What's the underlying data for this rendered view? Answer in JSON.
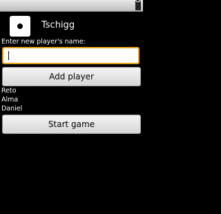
{
  "status_bar": {
    "time": "",
    "battery_level": 0.9
  },
  "app": {
    "title": "Tschigg",
    "icon": "dice-one-icon"
  },
  "form": {
    "name_label": "Enter new player's name:",
    "name_value": "",
    "name_placeholder": ""
  },
  "buttons": {
    "add_player": "Add player",
    "start_game": "Start game"
  },
  "players": [
    "Reto",
    "Alma",
    "Daniel"
  ]
}
